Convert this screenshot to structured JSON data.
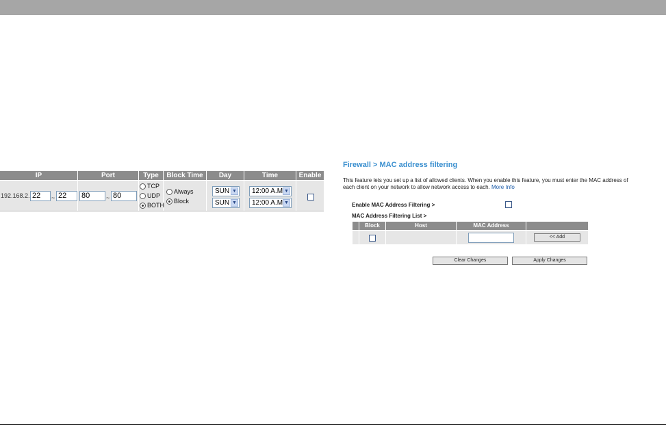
{
  "ip_filter": {
    "headers": [
      "IP",
      "Port",
      "Type",
      "Block Time",
      "Day",
      "Time",
      "Enable"
    ],
    "row": {
      "ip_prefix": "192.168.2.",
      "ip_start": "22",
      "ip_sep": "~",
      "ip_end": "22",
      "port_start": "80",
      "port_sep": "~",
      "port_end": "80",
      "type_options": [
        "TCP",
        "UDP",
        "BOTH"
      ],
      "type_selected": "BOTH",
      "block_time_options": [
        "Always",
        "Block"
      ],
      "block_time_selected": "Block",
      "day_from": "SUN",
      "day_to": "SUN",
      "time_from": "12:00 A.M.",
      "time_to": "12:00 A.M.",
      "enabled": false
    }
  },
  "mac_filter": {
    "title": "Firewall > MAC address filtering",
    "description": "This feature lets you set up a list of allowed clients. When you enable this feature, you must enter the MAC address of each client on your network to allow network access to each.",
    "more_info": "More Info",
    "enable_label": "Enable MAC Address Filtering >",
    "enable_checked": false,
    "list_label": "MAC Address Filtering List >",
    "table_headers": [
      "Block",
      "Host",
      "MAC Address"
    ],
    "add_button": "<< Add",
    "mac_input_value": "",
    "clear_button": "Clear Changes",
    "apply_button": "Apply Changes"
  },
  "icons": {
    "dropdown": "chevron-down-icon",
    "checkbox": "checkbox-icon",
    "radio": "radio-button-icon"
  },
  "colors": {
    "header_bg": "#8c8c8c",
    "row_bg": "#e6e6e6",
    "title_blue": "#3a8fcf",
    "top_bar": "#a6a6a6"
  }
}
